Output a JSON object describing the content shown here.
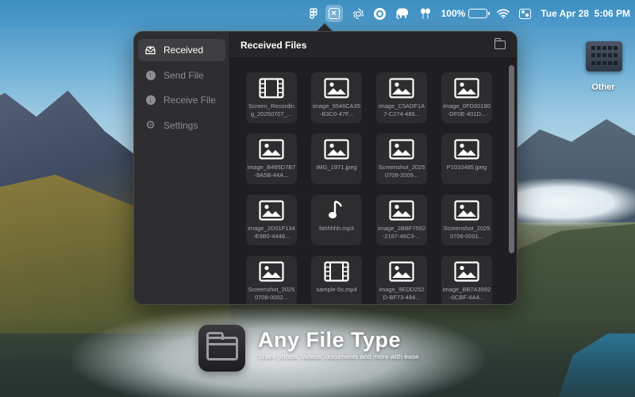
{
  "menubar": {
    "battery_percent": "100%",
    "battery_level": 1.0,
    "datetime": "Tue Apr 28  5:06 PM",
    "icons": [
      "figma-icon",
      "app-x-icon",
      "openai-icon",
      "ring-icon",
      "elephant-icon",
      "balloons-icon",
      "battery-icon",
      "wifi-icon",
      "control-center-icon"
    ]
  },
  "sidebar": {
    "items": [
      {
        "label": "Received",
        "icon": "tray-icon",
        "active": true
      },
      {
        "label": "Send File",
        "icon": "arrow-up-circle-icon",
        "active": false
      },
      {
        "label": "Receive File",
        "icon": "arrow-down-circle-icon",
        "active": false
      },
      {
        "label": "Settings",
        "icon": "gear-icon",
        "active": false
      }
    ]
  },
  "main": {
    "title": "Received Files",
    "header_icon": "folder-icon",
    "files": [
      {
        "name": "Screen_Recording_20250707_...",
        "type": "video"
      },
      {
        "name": "image_9546CA35-B3C0-47F...",
        "type": "image"
      },
      {
        "name": "image_C5ADF1A7-C274-486...",
        "type": "image"
      },
      {
        "name": "image_0FD60190-DF0E-401D...",
        "type": "image"
      },
      {
        "name": "image_B465D7B7-9A5B-44A...",
        "type": "image"
      },
      {
        "name": "IMG_1971.jpeg",
        "type": "image"
      },
      {
        "name": "Screenshot_20250708-2009...",
        "type": "image"
      },
      {
        "name": "P1010485.jpeg",
        "type": "image"
      },
      {
        "name": "image_2D01F134-E9B0-4448...",
        "type": "image"
      },
      {
        "name": "fahhhhh.mp3",
        "type": "audio"
      },
      {
        "name": "image_2BBF7592-2187-46C3-...",
        "type": "image"
      },
      {
        "name": "Screenshot_20250708-0001...",
        "type": "image"
      },
      {
        "name": "Screenshot_20250708-0002...",
        "type": "image"
      },
      {
        "name": "sample-5s.mp4",
        "type": "video"
      },
      {
        "name": "image_9EDD252D-BF73-484...",
        "type": "image"
      },
      {
        "name": "image_BB7A3992-0CBF-4A4...",
        "type": "image"
      }
    ]
  },
  "desktop": {
    "folder_label": "Other"
  },
  "promo": {
    "title": "Any File Type",
    "subtitle": "Share photos, videos, documents and more with ease"
  },
  "colors": {
    "popup_bg": "#232325",
    "sidebar_bg": "#2e2e30",
    "active_item_bg": "#3f3f42",
    "tile_bg": "#2d2d30",
    "menubar_bg": "#4d9acb"
  }
}
